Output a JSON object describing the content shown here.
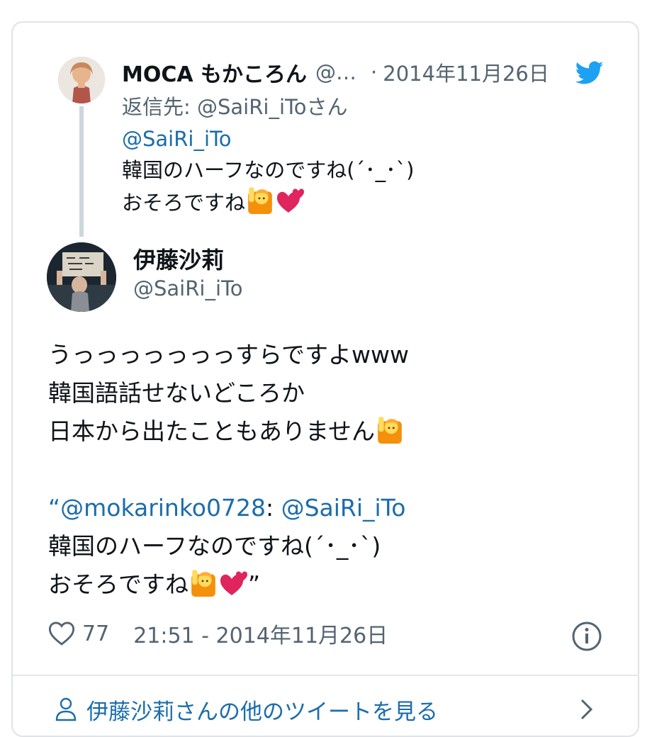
{
  "parent_tweet": {
    "name": "MOCA もかころん",
    "handle": "@…",
    "separator": "·",
    "date": "2014年11月26日",
    "reply_prefix": "返信先: ",
    "reply_target": "@SaiRi_iTo",
    "reply_suffix": "さん",
    "mention": "@SaiRi_iTo",
    "line1": "韓国のハーフなのですね(´･_･`)",
    "line2": "おそろですね"
  },
  "main_tweet": {
    "name": "伊藤沙莉",
    "handle": "@SaiRi_iTo",
    "line1": "うっっっっっっっすらですよwww",
    "line2": "韓国語話せないどころか",
    "line3": "日本から出たこともありません",
    "quote_open": "“",
    "quote_mention1": "@mokarinko0728",
    "quote_colon": ": ",
    "quote_mention2": "@SaiRi_iTo",
    "quote_line2": "韓国のハーフなのですね(´･_･`)",
    "quote_line3": "おそろですね",
    "quote_close": "”"
  },
  "meta": {
    "like_count": "77",
    "timestamp": "21:51 - 2014年11月26日"
  },
  "footer": {
    "more_tweets_label": "伊藤沙莉さんの他のツイートを見る"
  },
  "colors": {
    "link": "#1b6dab",
    "twitter_blue": "#1da1f2",
    "secondary_text": "#536471",
    "heart_emoji": "#e0245e"
  },
  "icons": [
    "twitter-bird-icon",
    "heart-icon",
    "info-icon",
    "person-icon",
    "chevron-right-icon",
    "person-raising-hand-emoji",
    "two-hearts-emoji"
  ]
}
